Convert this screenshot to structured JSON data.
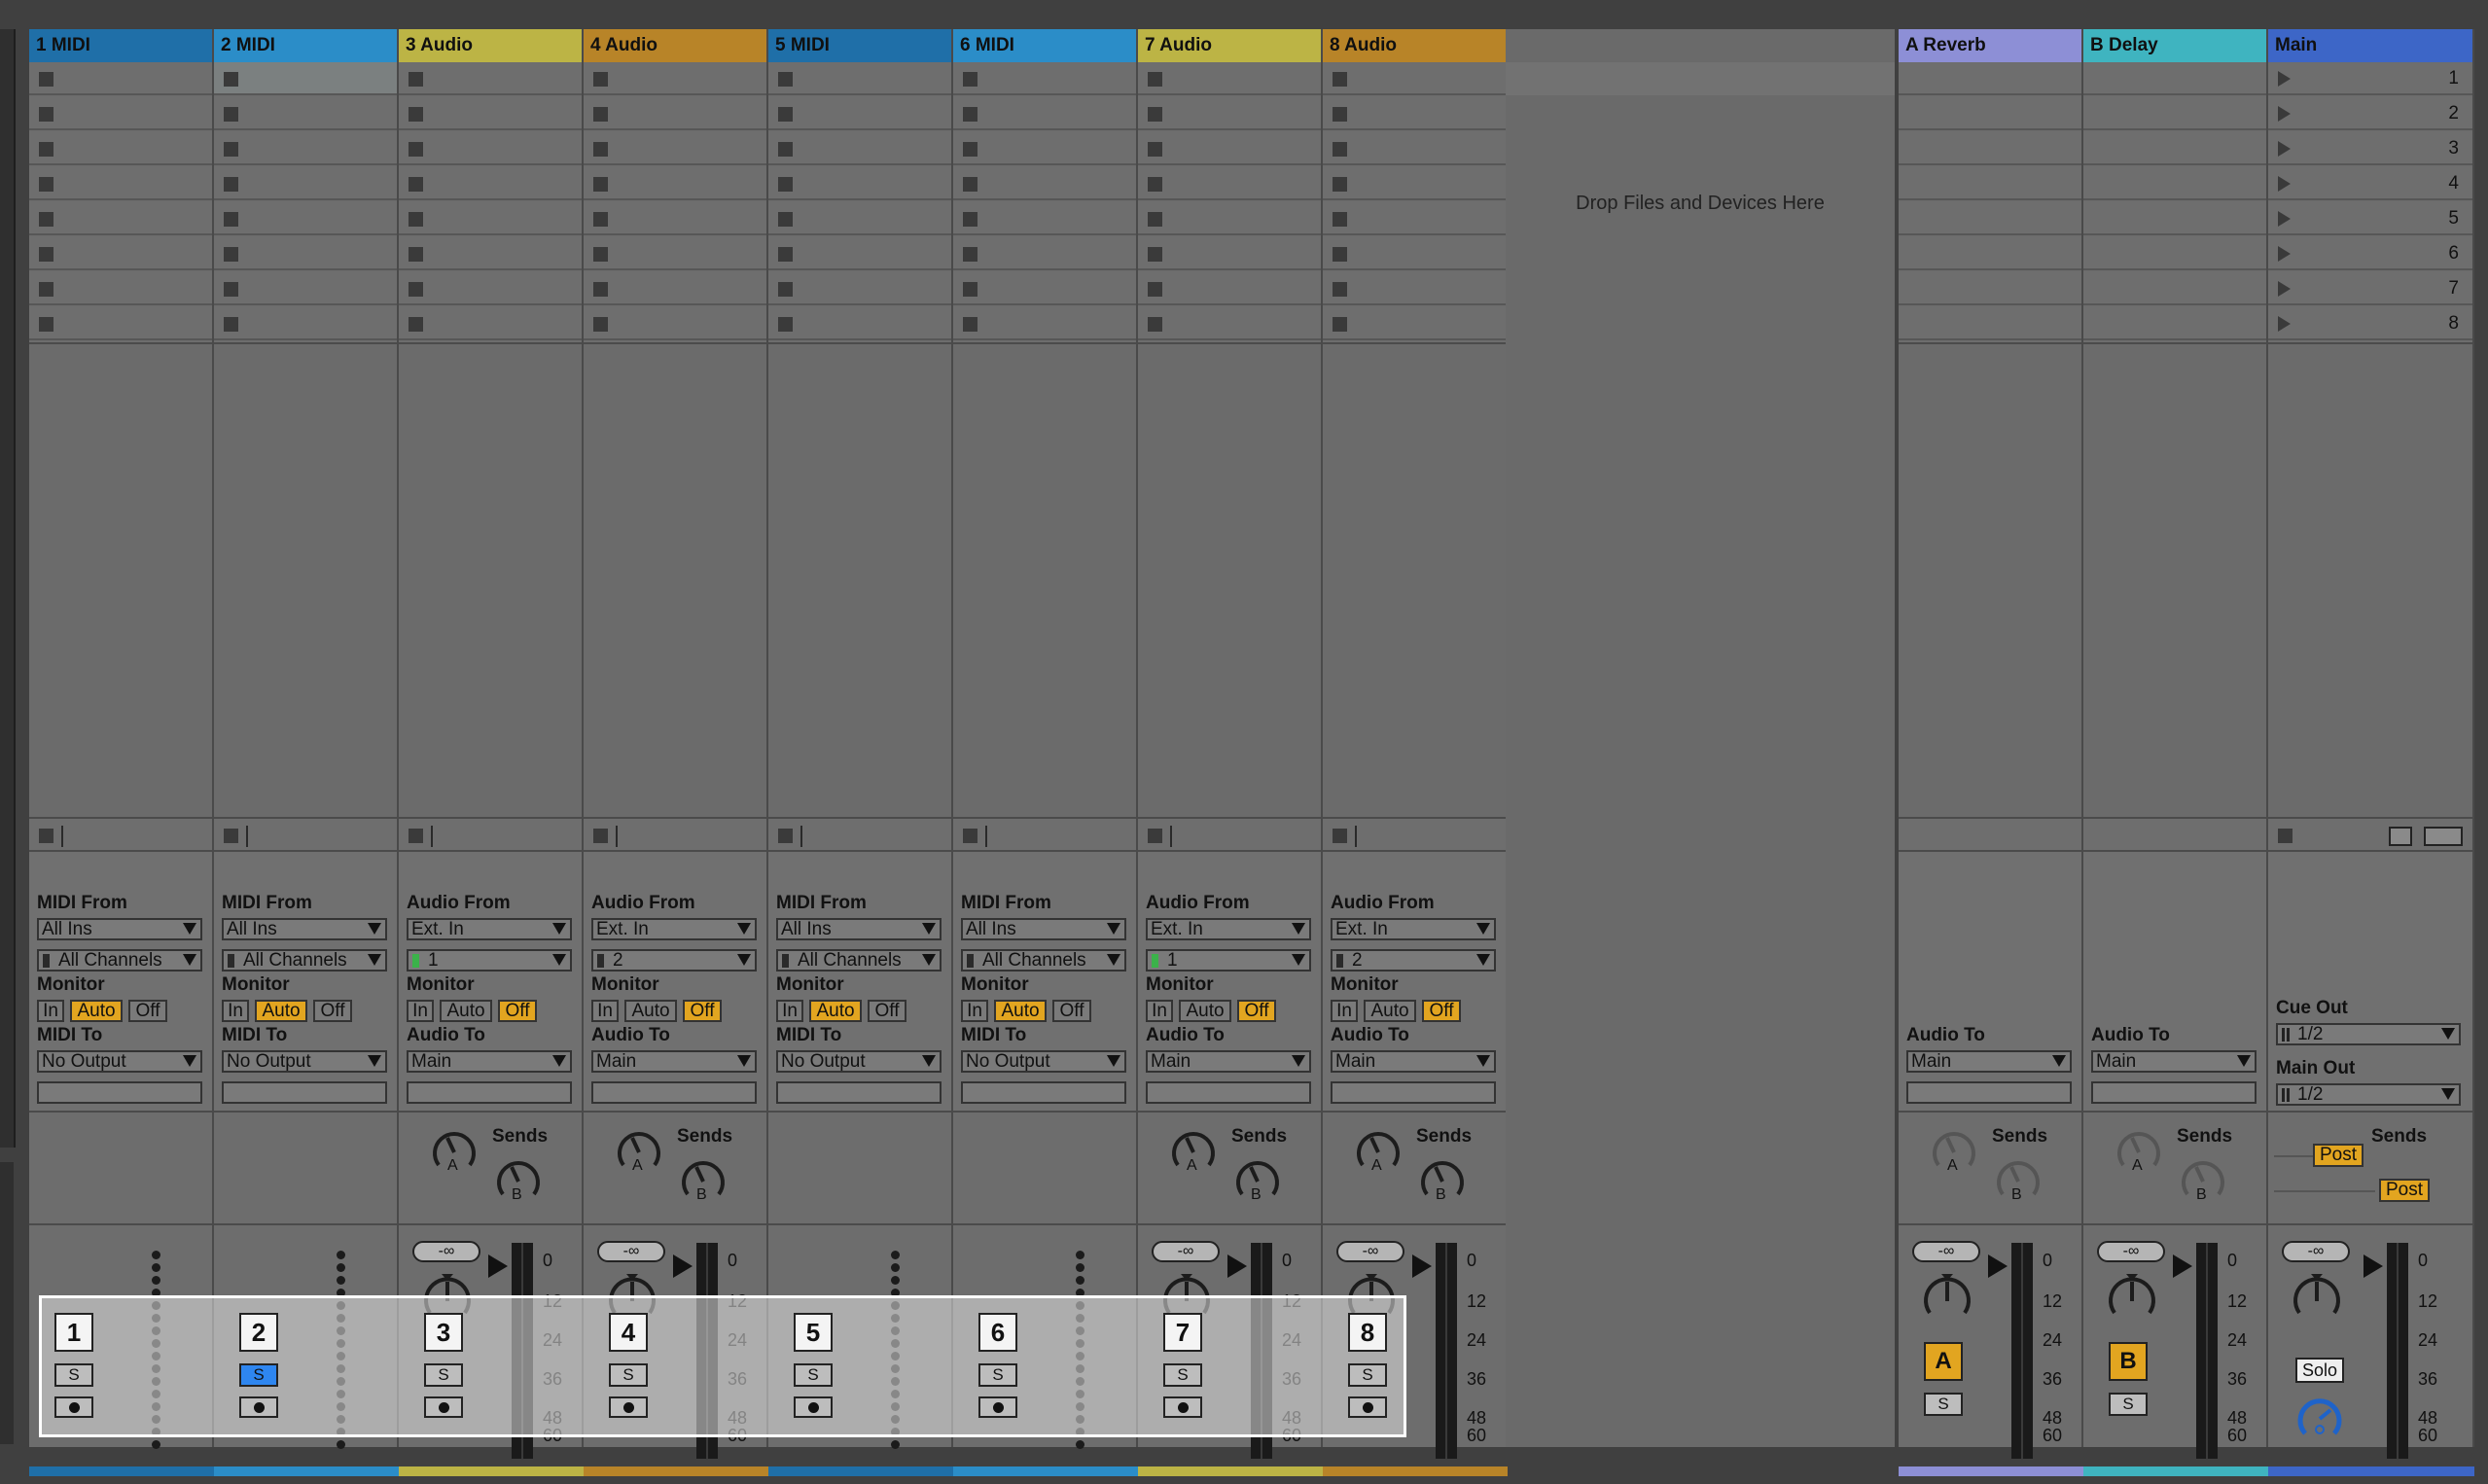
{
  "tracks": [
    {
      "name": "1 MIDI",
      "type": "midi",
      "color": "#1f6fa8",
      "num": "1",
      "from_label": "MIDI From",
      "from": "All Ins",
      "channel": "All Channels",
      "to_label": "MIDI To",
      "to": "No Output",
      "monitor_active": "Auto"
    },
    {
      "name": "2 MIDI",
      "type": "midi",
      "color": "#2b8dc8",
      "num": "2",
      "from_label": "MIDI From",
      "from": "All Ins",
      "channel": "All Channels",
      "to_label": "MIDI To",
      "to": "No Output",
      "monitor_active": "Auto",
      "solo_on": true
    },
    {
      "name": "3 Audio",
      "type": "audio",
      "color": "#bcb445",
      "num": "3",
      "from_label": "Audio From",
      "from": "Ext. In",
      "channel": "1",
      "to_label": "Audio To",
      "to": "Main",
      "monitor_active": "Off"
    },
    {
      "name": "4 Audio",
      "type": "audio",
      "color": "#b88428",
      "num": "4",
      "from_label": "Audio From",
      "from": "Ext. In",
      "channel": "2",
      "to_label": "Audio To",
      "to": "Main",
      "monitor_active": "Off"
    },
    {
      "name": "5 MIDI",
      "type": "midi",
      "color": "#1f6fa8",
      "num": "5",
      "from_label": "MIDI From",
      "from": "All Ins",
      "channel": "All Channels",
      "to_label": "MIDI To",
      "to": "No Output",
      "monitor_active": "Auto"
    },
    {
      "name": "6 MIDI",
      "type": "midi",
      "color": "#2b8dc8",
      "num": "6",
      "from_label": "MIDI From",
      "from": "All Ins",
      "channel": "All Channels",
      "to_label": "MIDI To",
      "to": "No Output",
      "monitor_active": "Auto"
    },
    {
      "name": "7 Audio",
      "type": "audio",
      "color": "#bcb445",
      "num": "7",
      "from_label": "Audio From",
      "from": "Ext. In",
      "channel": "1",
      "to_label": "Audio To",
      "to": "Main",
      "monitor_active": "Off"
    },
    {
      "name": "8 Audio",
      "type": "audio",
      "color": "#b88428",
      "num": "8",
      "from_label": "Audio From",
      "from": "Ext. In",
      "channel": "2",
      "to_label": "Audio To",
      "to": "Main",
      "monitor_active": "Off"
    }
  ],
  "monitor": {
    "label": "Monitor",
    "in": "In",
    "auto": "Auto",
    "off": "Off"
  },
  "sends_label": "Sends",
  "knob_a": "A",
  "knob_b": "B",
  "solo_label": "S",
  "volume_readout": "-∞",
  "meter_scale": [
    "0",
    "12",
    "24",
    "36",
    "48",
    "60"
  ],
  "drop_zone": "Drop Files and Devices Here",
  "returns": [
    {
      "name": "A Reverb",
      "color": "#8d8fd6",
      "letter": "A",
      "to_label": "Audio To",
      "to": "Main"
    },
    {
      "name": "B Delay",
      "color": "#3fb4c0",
      "letter": "B",
      "to_label": "Audio To",
      "to": "Main"
    }
  ],
  "main": {
    "name": "Main",
    "color": "#3d66c7",
    "cue_out_label": "Cue Out",
    "cue_out": "1/2",
    "main_out_label": "Main Out",
    "main_out": "1/2",
    "post1": "Post",
    "post2": "Post",
    "solo": "Solo"
  },
  "scenes": [
    "1",
    "2",
    "3",
    "4",
    "5",
    "6",
    "7",
    "8"
  ]
}
